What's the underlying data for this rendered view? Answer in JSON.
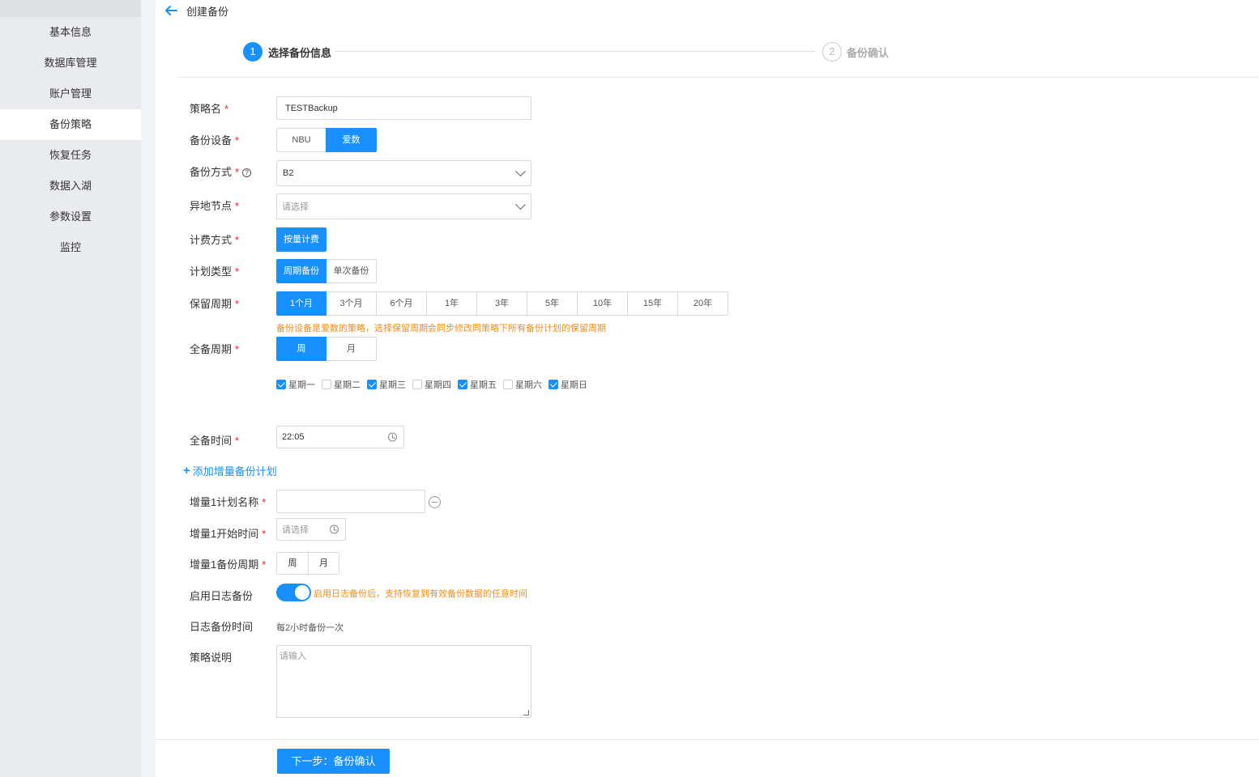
{
  "sidebar": {
    "items": [
      {
        "label": "基本信息"
      },
      {
        "label": "数据库管理"
      },
      {
        "label": "账户管理"
      },
      {
        "label": "备份策略",
        "active": true
      },
      {
        "label": "恢复任务"
      },
      {
        "label": "数据入湖"
      },
      {
        "label": "参数设置"
      },
      {
        "label": "监控"
      }
    ]
  },
  "header": {
    "title": "创建备份"
  },
  "steps": [
    {
      "num": "1",
      "label": "选择备份信息",
      "status": "active"
    },
    {
      "num": "2",
      "label": "备份确认",
      "status": "todo"
    }
  ],
  "form": {
    "policy_name": {
      "label": "策略名",
      "value": "TESTBackup"
    },
    "device": {
      "label": "备份设备",
      "options": [
        "NBU",
        "爱数"
      ],
      "selected": "爱数"
    },
    "method": {
      "label": "备份方式",
      "value": "B2"
    },
    "remote_node": {
      "label": "异地节点",
      "placeholder": "请选择"
    },
    "billing": {
      "label": "计费方式",
      "options": [
        "按量计费"
      ],
      "selected": "按量计费"
    },
    "plan_type": {
      "label": "计划类型",
      "options": [
        "周期备份",
        "单次备份"
      ],
      "selected": "周期备份"
    },
    "retention": {
      "label": "保留周期",
      "options": [
        "1个月",
        "3个月",
        "6个月",
        "1年",
        "3年",
        "5年",
        "10年",
        "15年",
        "20年"
      ],
      "selected": "1个月",
      "hint": "备份设备是爱数的策略，选择保留周期会同步修改同策略下所有备份计划的保留周期"
    },
    "full_cycle": {
      "label": "全备周期",
      "options": [
        "周",
        "月"
      ],
      "selected": "周",
      "days": [
        {
          "label": "星期一",
          "checked": true
        },
        {
          "label": "星期二",
          "checked": false
        },
        {
          "label": "星期三",
          "checked": true
        },
        {
          "label": "星期四",
          "checked": false
        },
        {
          "label": "星期五",
          "checked": true
        },
        {
          "label": "星期六",
          "checked": false
        },
        {
          "label": "星期日",
          "checked": true
        }
      ]
    },
    "full_time": {
      "label": "全备时间",
      "value": "22:05"
    },
    "add_incremental": "添加增量备份计划",
    "inc_name": {
      "label": "增量1计划名称",
      "value": ""
    },
    "inc_start": {
      "label": "增量1开始时间",
      "placeholder": "请选择"
    },
    "inc_cycle": {
      "label": "增量1备份周期",
      "options": [
        "周",
        "月"
      ]
    },
    "log_backup": {
      "label": "启用日志备份",
      "enabled": true,
      "hint": "启用日志备份后，支持恢复到有效备份数据的任意时间"
    },
    "log_time": {
      "label": "日志备份时间",
      "value": "每2小时备份一次"
    },
    "description": {
      "label": "策略说明",
      "placeholder": "请输入"
    }
  },
  "footer": {
    "next_label": "下一步：备份确认"
  },
  "colors": {
    "primary": "#1890ff",
    "warning": "#fa8c16",
    "required": "#f5222d",
    "sidebar_bg": "#eaebee"
  }
}
